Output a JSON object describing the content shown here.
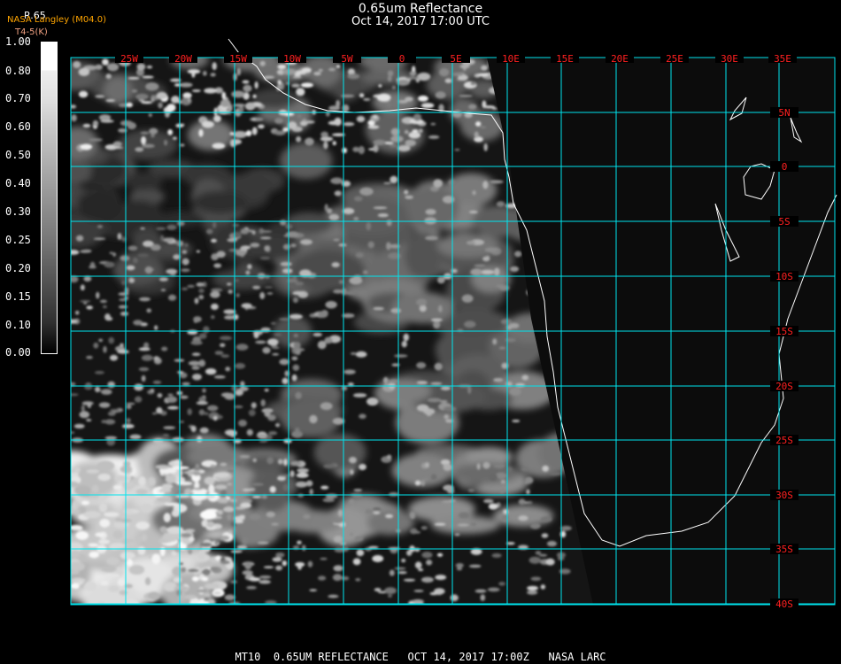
{
  "header": {
    "title": "0.65um Reflectance",
    "datetime": "Oct 14, 2017 17:00 UTC"
  },
  "legend": {
    "organization": "NASA Langley (M04.0)",
    "channel": "R.65",
    "units": "T4-5(K)",
    "ticks": [
      "1.00",
      "0.80",
      "0.70",
      "0.60",
      "0.50",
      "0.40",
      "0.30",
      "0.25",
      "0.20",
      "0.15",
      "0.10",
      "0.00"
    ]
  },
  "map": {
    "longitude_labels": [
      "25W",
      "20W",
      "15W",
      "10W",
      "5W",
      "0",
      "5E",
      "10E",
      "15E",
      "20E",
      "25E",
      "30E",
      "35E"
    ],
    "latitude_labels": [
      "5N",
      "0",
      "5S",
      "10S",
      "15S",
      "20S",
      "25S",
      "30S",
      "35S",
      "40S"
    ],
    "grid_color": "#00e5ee",
    "label_color": "#ff2020",
    "coast_color": "#ffffff"
  },
  "footer": "MT10  0.65UM REFLECTANCE   OCT 14, 2017 17:00Z   NASA LARC"
}
